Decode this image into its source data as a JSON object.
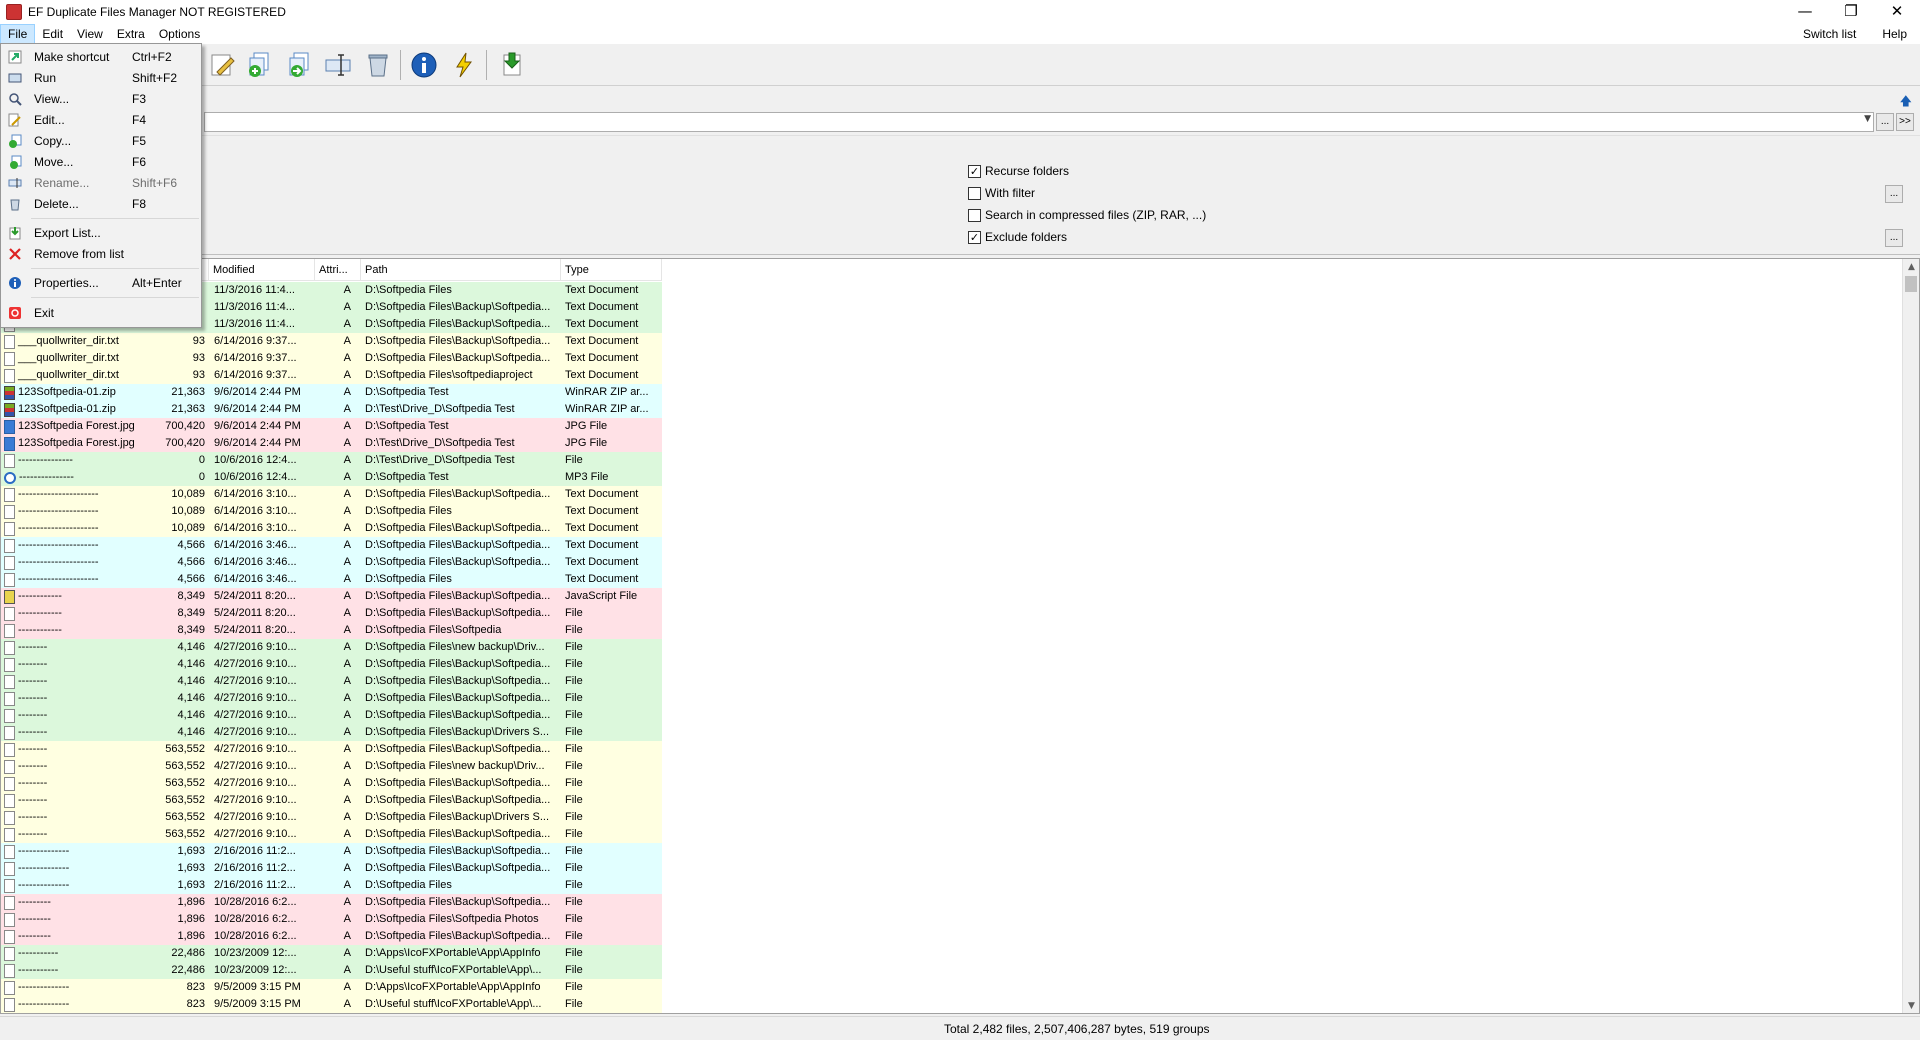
{
  "window": {
    "title": "EF Duplicate Files Manager NOT REGISTERED",
    "minimize": "—",
    "maximize": "❐",
    "close": "✕"
  },
  "menubar": {
    "items": [
      "File",
      "Edit",
      "View",
      "Extra",
      "Options"
    ],
    "right_items": [
      "Switch list",
      "Help"
    ]
  },
  "file_menu": {
    "items": [
      {
        "label": "Make shortcut",
        "shortcut": "Ctrl+F2",
        "icon": "shortcut-icon"
      },
      {
        "label": "Run",
        "shortcut": "Shift+F2",
        "icon": "run-icon"
      },
      {
        "label": "View...",
        "shortcut": "F3",
        "icon": "view-icon"
      },
      {
        "label": "Edit...",
        "shortcut": "F4",
        "icon": "edit-icon"
      },
      {
        "label": "Copy...",
        "shortcut": "F5",
        "icon": "copy-icon"
      },
      {
        "label": "Move...",
        "shortcut": "F6",
        "icon": "move-icon"
      },
      {
        "label": "Rename...",
        "shortcut": "Shift+F6",
        "icon": "rename-icon"
      },
      {
        "label": "Delete...",
        "shortcut": "F8",
        "icon": "delete-icon"
      },
      {
        "label": "Export List...",
        "shortcut": "",
        "icon": "export-icon"
      },
      {
        "label": "Remove from list",
        "shortcut": "",
        "icon": "remove-icon"
      },
      {
        "label": "Properties...",
        "shortcut": "Alt+Enter",
        "icon": "info-icon"
      },
      {
        "label": "Exit",
        "shortcut": "",
        "icon": "exit-icon"
      }
    ]
  },
  "path_combo": {
    "value": "",
    "browse": "...",
    "add": ">>"
  },
  "options": {
    "recurse_folders": {
      "label": "Recurse folders",
      "checked": true
    },
    "with_filter": {
      "label": "With filter",
      "checked": false
    },
    "search_compressed": {
      "label": "Search in compressed files (ZIP, RAR, ...)",
      "checked": false
    },
    "exclude_folders": {
      "label": "Exclude folders",
      "checked": true
    },
    "filter_btn": "...",
    "exclude_btn": "..."
  },
  "columns": {
    "name": "",
    "size": "",
    "modified": "Modified",
    "attributes": "Attri...",
    "path": "Path",
    "type": "Type"
  },
  "rows": [
    {
      "name": "",
      "size": "",
      "modified": "11/3/2016  11:4...",
      "attr": "A",
      "path": "D:\\Softpedia Files",
      "type": "Text Document",
      "bg": "g",
      "icon": "txt"
    },
    {
      "name": "",
      "size": "",
      "modified": "11/3/2016  11:4...",
      "attr": "A",
      "path": "D:\\Softpedia Files\\Backup\\Softpedia...",
      "type": "Text Document",
      "bg": "g",
      "icon": "txt"
    },
    {
      "name": "",
      "size": "",
      "modified": "11/3/2016  11:4...",
      "attr": "A",
      "path": "D:\\Softpedia Files\\Backup\\Softpedia...",
      "type": "Text Document",
      "bg": "g",
      "icon": "txt"
    },
    {
      "name": "___quollwriter_dir.txt",
      "size": "93",
      "modified": "6/14/2016  9:37...",
      "attr": "A",
      "path": "D:\\Softpedia Files\\Backup\\Softpedia...",
      "type": "Text Document",
      "bg": "y",
      "icon": "txt"
    },
    {
      "name": "___quollwriter_dir.txt",
      "size": "93",
      "modified": "6/14/2016  9:37...",
      "attr": "A",
      "path": "D:\\Softpedia Files\\Backup\\Softpedia...",
      "type": "Text Document",
      "bg": "y",
      "icon": "txt"
    },
    {
      "name": "___quollwriter_dir.txt",
      "size": "93",
      "modified": "6/14/2016  9:37...",
      "attr": "A",
      "path": "D:\\Softpedia Files\\softpediaproject",
      "type": "Text Document",
      "bg": "y",
      "icon": "txt"
    },
    {
      "name": "123Softpedia-01.zip",
      "size": "21,363",
      "modified": "9/6/2014  2:44 PM",
      "attr": "A",
      "path": "D:\\Softpedia Test",
      "type": "WinRAR ZIP ar...",
      "bg": "c",
      "icon": "zip"
    },
    {
      "name": "123Softpedia-01.zip",
      "size": "21,363",
      "modified": "9/6/2014  2:44 PM",
      "attr": "A",
      "path": "D:\\Test\\Drive_D\\Softpedia Test",
      "type": "WinRAR ZIP ar...",
      "bg": "c",
      "icon": "zip"
    },
    {
      "name": "123Softpedia Forest.jpg",
      "size": "700,420",
      "modified": "9/6/2014  2:44 PM",
      "attr": "A",
      "path": "D:\\Softpedia Test",
      "type": "JPG File",
      "bg": "r",
      "icon": "jpg"
    },
    {
      "name": "123Softpedia Forest.jpg",
      "size": "700,420",
      "modified": "9/6/2014  2:44 PM",
      "attr": "A",
      "path": "D:\\Test\\Drive_D\\Softpedia Test",
      "type": "JPG File",
      "bg": "r",
      "icon": "jpg"
    },
    {
      "name": "---------------",
      "size": "0",
      "modified": "10/6/2016  12:4...",
      "attr": "A",
      "path": "D:\\Test\\Drive_D\\Softpedia Test",
      "type": "File",
      "bg": "g",
      "icon": "txt"
    },
    {
      "name": "---------------",
      "size": "0",
      "modified": "10/6/2016  12:4...",
      "attr": "A",
      "path": "D:\\Softpedia Test",
      "type": "MP3 File",
      "bg": "g",
      "icon": "mp3"
    },
    {
      "name": "----------------------",
      "size": "10,089",
      "modified": "6/14/2016  3:10...",
      "attr": "A",
      "path": "D:\\Softpedia Files\\Backup\\Softpedia...",
      "type": "Text Document",
      "bg": "y",
      "icon": "txt"
    },
    {
      "name": "----------------------",
      "size": "10,089",
      "modified": "6/14/2016  3:10...",
      "attr": "A",
      "path": "D:\\Softpedia Files",
      "type": "Text Document",
      "bg": "y",
      "icon": "txt"
    },
    {
      "name": "----------------------",
      "size": "10,089",
      "modified": "6/14/2016  3:10...",
      "attr": "A",
      "path": "D:\\Softpedia Files\\Backup\\Softpedia...",
      "type": "Text Document",
      "bg": "y",
      "icon": "txt"
    },
    {
      "name": "----------------------",
      "size": "4,566",
      "modified": "6/14/2016  3:46...",
      "attr": "A",
      "path": "D:\\Softpedia Files\\Backup\\Softpedia...",
      "type": "Text Document",
      "bg": "c",
      "icon": "txt"
    },
    {
      "name": "----------------------",
      "size": "4,566",
      "modified": "6/14/2016  3:46...",
      "attr": "A",
      "path": "D:\\Softpedia Files\\Backup\\Softpedia...",
      "type": "Text Document",
      "bg": "c",
      "icon": "txt"
    },
    {
      "name": "----------------------",
      "size": "4,566",
      "modified": "6/14/2016  3:46...",
      "attr": "A",
      "path": "D:\\Softpedia Files",
      "type": "Text Document",
      "bg": "c",
      "icon": "txt"
    },
    {
      "name": "------------",
      "size": "8,349",
      "modified": "5/24/2011  8:20...",
      "attr": "A",
      "path": "D:\\Softpedia Files\\Backup\\Softpedia...",
      "type": "JavaScript File",
      "bg": "r",
      "icon": "js"
    },
    {
      "name": "------------",
      "size": "8,349",
      "modified": "5/24/2011  8:20...",
      "attr": "A",
      "path": "D:\\Softpedia Files\\Backup\\Softpedia...",
      "type": "File",
      "bg": "r",
      "icon": "txt"
    },
    {
      "name": "------------",
      "size": "8,349",
      "modified": "5/24/2011  8:20...",
      "attr": "A",
      "path": "D:\\Softpedia Files\\Softpedia",
      "type": "File",
      "bg": "r",
      "icon": "txt"
    },
    {
      "name": "--------",
      "size": "4,146",
      "modified": "4/27/2016  9:10...",
      "attr": "A",
      "path": "D:\\Softpedia Files\\new backup\\Driv...",
      "type": "File",
      "bg": "g",
      "icon": "txt"
    },
    {
      "name": "--------",
      "size": "4,146",
      "modified": "4/27/2016  9:10...",
      "attr": "A",
      "path": "D:\\Softpedia Files\\Backup\\Softpedia...",
      "type": "File",
      "bg": "g",
      "icon": "txt"
    },
    {
      "name": "--------",
      "size": "4,146",
      "modified": "4/27/2016  9:10...",
      "attr": "A",
      "path": "D:\\Softpedia Files\\Backup\\Softpedia...",
      "type": "File",
      "bg": "g",
      "icon": "txt"
    },
    {
      "name": "--------",
      "size": "4,146",
      "modified": "4/27/2016  9:10...",
      "attr": "A",
      "path": "D:\\Softpedia Files\\Backup\\Softpedia...",
      "type": "File",
      "bg": "g",
      "icon": "txt"
    },
    {
      "name": "--------",
      "size": "4,146",
      "modified": "4/27/2016  9:10...",
      "attr": "A",
      "path": "D:\\Softpedia Files\\Backup\\Softpedia...",
      "type": "File",
      "bg": "g",
      "icon": "txt"
    },
    {
      "name": "--------",
      "size": "4,146",
      "modified": "4/27/2016  9:10...",
      "attr": "A",
      "path": "D:\\Softpedia Files\\Backup\\Drivers S...",
      "type": "File",
      "bg": "g",
      "icon": "txt"
    },
    {
      "name": "--------",
      "size": "563,552",
      "modified": "4/27/2016  9:10...",
      "attr": "A",
      "path": "D:\\Softpedia Files\\Backup\\Softpedia...",
      "type": "File",
      "bg": "y",
      "icon": "txt"
    },
    {
      "name": "--------",
      "size": "563,552",
      "modified": "4/27/2016  9:10...",
      "attr": "A",
      "path": "D:\\Softpedia Files\\new backup\\Driv...",
      "type": "File",
      "bg": "y",
      "icon": "txt"
    },
    {
      "name": "--------",
      "size": "563,552",
      "modified": "4/27/2016  9:10...",
      "attr": "A",
      "path": "D:\\Softpedia Files\\Backup\\Softpedia...",
      "type": "File",
      "bg": "y",
      "icon": "txt"
    },
    {
      "name": "--------",
      "size": "563,552",
      "modified": "4/27/2016  9:10...",
      "attr": "A",
      "path": "D:\\Softpedia Files\\Backup\\Softpedia...",
      "type": "File",
      "bg": "y",
      "icon": "txt"
    },
    {
      "name": "--------",
      "size": "563,552",
      "modified": "4/27/2016  9:10...",
      "attr": "A",
      "path": "D:\\Softpedia Files\\Backup\\Drivers S...",
      "type": "File",
      "bg": "y",
      "icon": "txt"
    },
    {
      "name": "--------",
      "size": "563,552",
      "modified": "4/27/2016  9:10...",
      "attr": "A",
      "path": "D:\\Softpedia Files\\Backup\\Softpedia...",
      "type": "File",
      "bg": "y",
      "icon": "txt"
    },
    {
      "name": "--------------",
      "size": "1,693",
      "modified": "2/16/2016  11:2...",
      "attr": "A",
      "path": "D:\\Softpedia Files\\Backup\\Softpedia...",
      "type": "File",
      "bg": "c",
      "icon": "txt"
    },
    {
      "name": "--------------",
      "size": "1,693",
      "modified": "2/16/2016  11:2...",
      "attr": "A",
      "path": "D:\\Softpedia Files\\Backup\\Softpedia...",
      "type": "File",
      "bg": "c",
      "icon": "txt"
    },
    {
      "name": "--------------",
      "size": "1,693",
      "modified": "2/16/2016  11:2...",
      "attr": "A",
      "path": "D:\\Softpedia Files",
      "type": "File",
      "bg": "c",
      "icon": "txt"
    },
    {
      "name": "---------",
      "size": "1,896",
      "modified": "10/28/2016  6:2...",
      "attr": "A",
      "path": "D:\\Softpedia Files\\Backup\\Softpedia...",
      "type": "File",
      "bg": "r",
      "icon": "txt"
    },
    {
      "name": "---------",
      "size": "1,896",
      "modified": "10/28/2016  6:2...",
      "attr": "A",
      "path": "D:\\Softpedia Files\\Softpedia Photos",
      "type": "File",
      "bg": "r",
      "icon": "txt"
    },
    {
      "name": "---------",
      "size": "1,896",
      "modified": "10/28/2016  6:2...",
      "attr": "A",
      "path": "D:\\Softpedia Files\\Backup\\Softpedia...",
      "type": "File",
      "bg": "r",
      "icon": "txt"
    },
    {
      "name": "-----------",
      "size": "22,486",
      "modified": "10/23/2009  12:...",
      "attr": "A",
      "path": "D:\\Apps\\IcoFXPortable\\App\\AppInfo",
      "type": "File",
      "bg": "g",
      "icon": "txt"
    },
    {
      "name": "-----------",
      "size": "22,486",
      "modified": "10/23/2009  12:...",
      "attr": "A",
      "path": "D:\\Useful stuff\\IcoFXPortable\\App\\...",
      "type": "File",
      "bg": "g",
      "icon": "txt"
    },
    {
      "name": "--------------",
      "size": "823",
      "modified": "9/5/2009  3:15 PM",
      "attr": "A",
      "path": "D:\\Apps\\IcoFXPortable\\App\\AppInfo",
      "type": "File",
      "bg": "y",
      "icon": "txt"
    },
    {
      "name": "--------------",
      "size": "823",
      "modified": "9/5/2009  3:15 PM",
      "attr": "A",
      "path": "D:\\Useful stuff\\IcoFXPortable\\App\\...",
      "type": "File",
      "bg": "y",
      "icon": "txt"
    }
  ],
  "status": "Total 2,482 files, 2,507,406,287 bytes, 519 groups"
}
